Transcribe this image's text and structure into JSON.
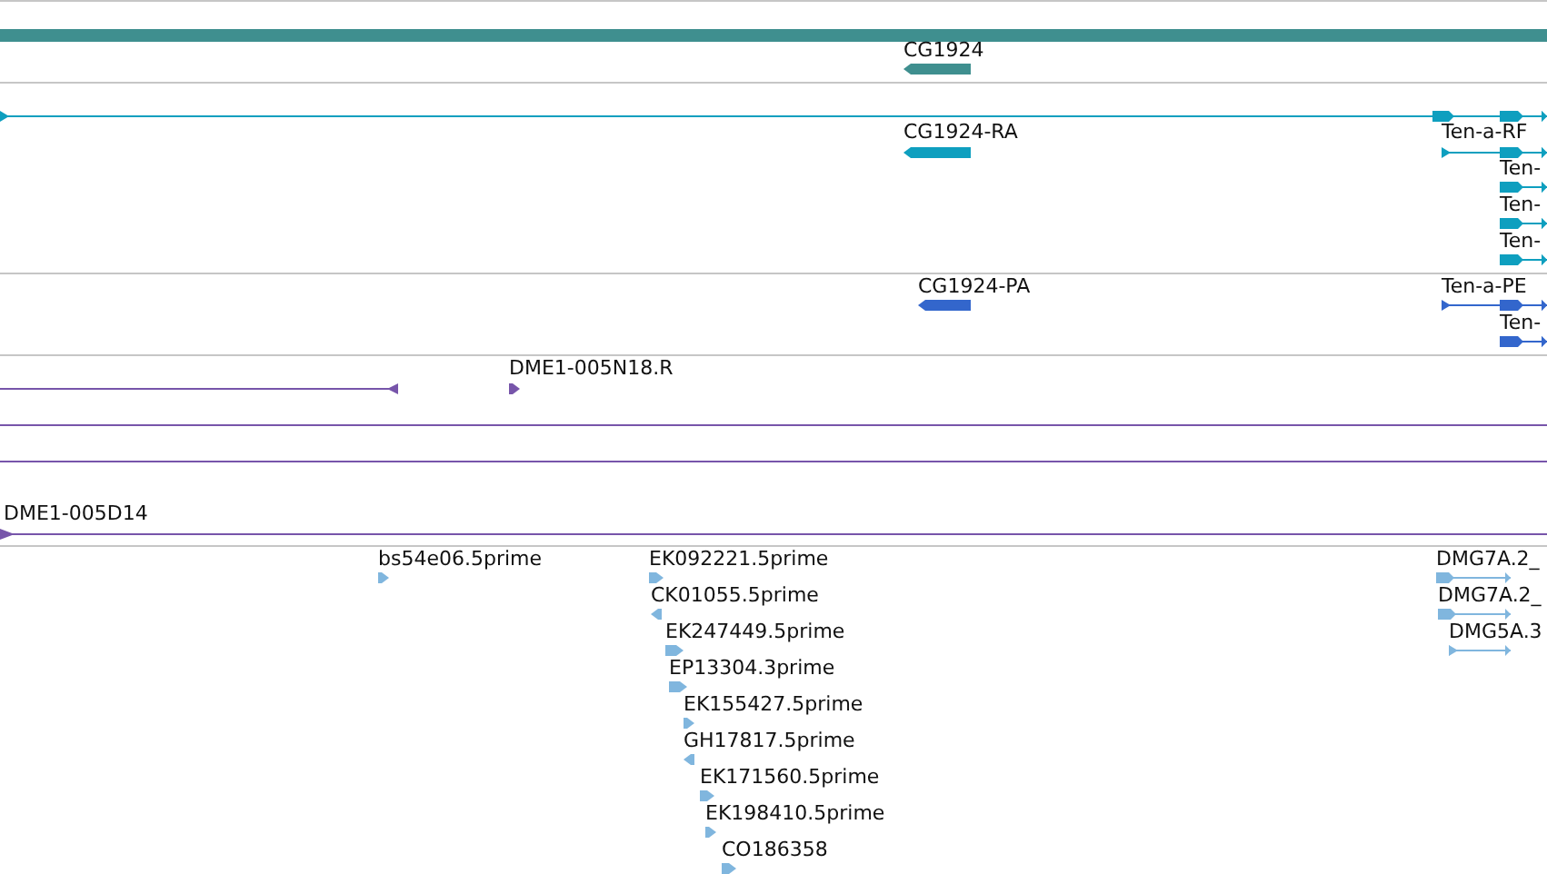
{
  "tracks": [
    {
      "color": "#3f8f8f",
      "features": [
        {
          "kind": "bar"
        },
        {
          "kind": "block",
          "label": "CG1924",
          "reverse": true
        }
      ]
    },
    {
      "color": "#0e9fbf",
      "features": [
        {
          "kind": "transcript",
          "reverse": false
        },
        {
          "kind": "block",
          "label": "CG1924-RA",
          "reverse": true
        },
        {
          "kind": "transcript",
          "label": "Ten-a-RF",
          "reverse": false
        },
        {
          "kind": "transcript",
          "label": "Ten-",
          "reverse": false
        },
        {
          "kind": "transcript",
          "label": "Ten-",
          "reverse": false
        },
        {
          "kind": "transcript",
          "label": "Ten-",
          "reverse": false
        }
      ]
    },
    {
      "color": "#3366cc",
      "features": [
        {
          "kind": "block",
          "label": "CG1924-PA",
          "reverse": true
        },
        {
          "kind": "transcript",
          "label": "Ten-a-PE",
          "reverse": false
        },
        {
          "kind": "transcript",
          "label": "Ten-",
          "reverse": false
        }
      ]
    },
    {
      "color": "#7755aa",
      "features": [
        {
          "kind": "line",
          "reverse": true
        },
        {
          "kind": "block",
          "label": "DME1-005N18.R",
          "reverse": false
        },
        {
          "kind": "line"
        },
        {
          "kind": "line"
        },
        {
          "kind": "line",
          "label": "DME1-005D14",
          "reverse": false
        }
      ]
    },
    {
      "color": "#80b6de",
      "features": [
        {
          "kind": "block",
          "label": "bs54e06.5prime",
          "reverse": false
        },
        {
          "kind": "block",
          "label": "EK092221.5prime",
          "reverse": false
        },
        {
          "kind": "block",
          "label": "CK01055.5prime",
          "reverse": true
        },
        {
          "kind": "block",
          "label": "EK247449.5prime",
          "reverse": false
        },
        {
          "kind": "block",
          "label": "EP13304.3prime",
          "reverse": false
        },
        {
          "kind": "block",
          "label": "EK155427.5prime",
          "reverse": false
        },
        {
          "kind": "block",
          "label": "GH17817.5prime",
          "reverse": true
        },
        {
          "kind": "block",
          "label": "EK171560.5prime",
          "reverse": false
        },
        {
          "kind": "block",
          "label": "EK198410.5prime",
          "reverse": false
        },
        {
          "kind": "block",
          "label": "CO186358",
          "reverse": false
        },
        {
          "kind": "transcript",
          "label": "DMG7A.2_",
          "reverse": false
        },
        {
          "kind": "transcript",
          "label": "DMG7A.2_",
          "reverse": false
        },
        {
          "kind": "transcript",
          "label": "DMG5A.3",
          "reverse": false
        }
      ]
    }
  ]
}
